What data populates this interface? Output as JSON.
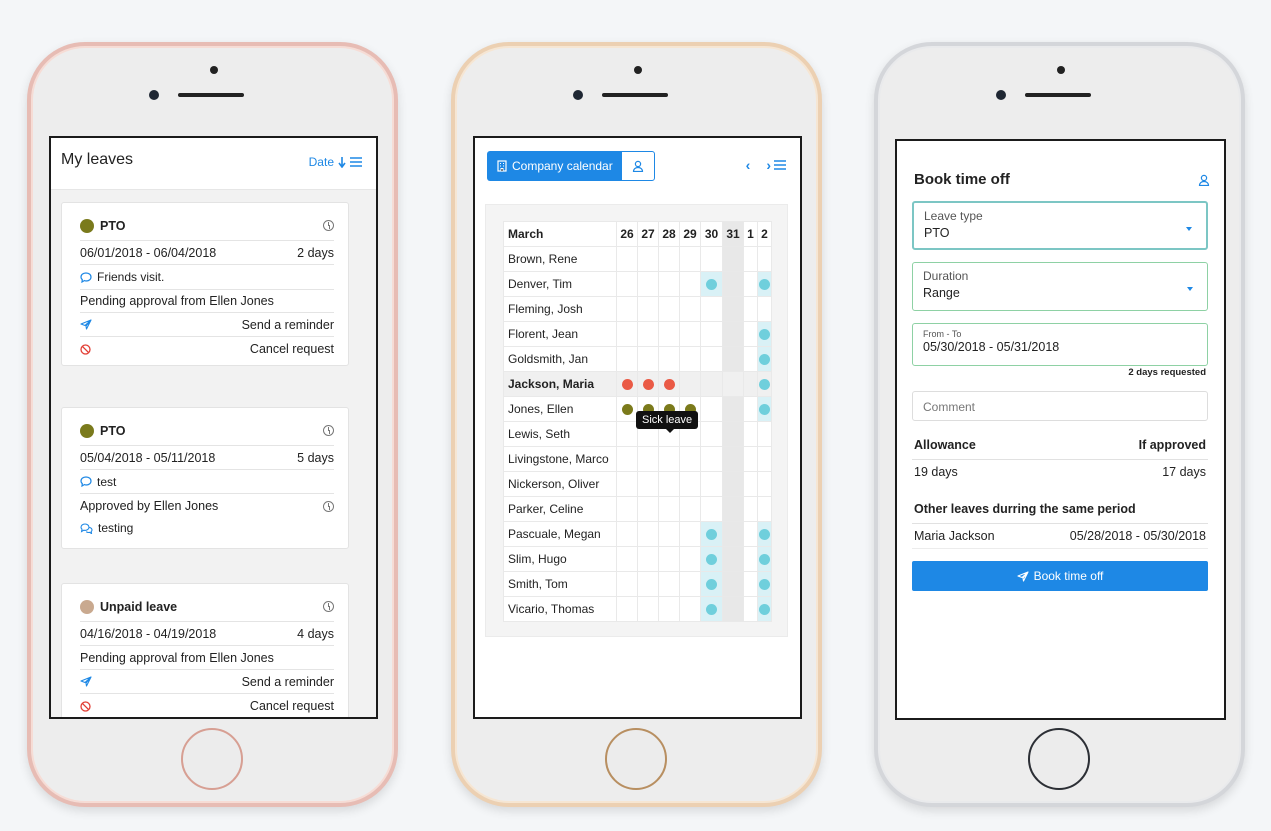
{
  "phone1": {
    "title": "My leaves",
    "sort_label": "Date",
    "cards": [
      {
        "type": "PTO",
        "color": "#7a7a1c",
        "dates": "06/01/2018 - 06/04/2018",
        "duration": "2 days",
        "note": "Friends visit.",
        "status": "Pending approval from Ellen Jones",
        "reminder": "Send a reminder",
        "cancel": "Cancel request"
      },
      {
        "type": "PTO",
        "color": "#7a7a1c",
        "dates": "05/04/2018 - 05/11/2018",
        "duration": "5 days",
        "note": "test",
        "status": "Approved by Ellen Jones",
        "reply": "testing"
      },
      {
        "type": "Unpaid leave",
        "color": "#c9a98f",
        "dates": "04/16/2018 - 04/19/2018",
        "duration": "4 days",
        "status": "Pending approval from Ellen Jones",
        "reminder": "Send a reminder",
        "cancel": "Cancel request"
      }
    ]
  },
  "phone2": {
    "calendar_label": "Company calendar",
    "month": "March",
    "days": [
      "26",
      "27",
      "28",
      "29",
      "30",
      "31",
      "1",
      "2"
    ],
    "tooltip": "Sick leave",
    "rows": [
      {
        "name": "Brown, Rene",
        "marks": [
          "",
          "",
          "",
          "",
          "",
          "",
          "",
          ""
        ]
      },
      {
        "name": "Denver, Tim",
        "marks": [
          "",
          "",
          "",
          "",
          "cy",
          "",
          "",
          "cy"
        ]
      },
      {
        "name": "Fleming, Josh",
        "marks": [
          "",
          "",
          "",
          "",
          "",
          "",
          "",
          ""
        ]
      },
      {
        "name": "Florent, Jean",
        "marks": [
          "",
          "",
          "",
          "",
          "",
          "",
          "",
          "cy"
        ]
      },
      {
        "name": "Goldsmith, Jan",
        "marks": [
          "",
          "",
          "",
          "",
          "",
          "",
          "",
          "cy"
        ]
      },
      {
        "name": "Jackson, Maria",
        "marks": [
          "rd",
          "rd",
          "rd",
          "",
          "",
          "",
          "",
          "cy"
        ],
        "highlight": true
      },
      {
        "name": "Jones, Ellen",
        "marks": [
          "ol",
          "ol",
          "ol",
          "ol",
          "",
          "",
          "",
          "cy"
        ]
      },
      {
        "name": "Lewis, Seth",
        "marks": [
          "",
          "",
          "",
          "",
          "",
          "",
          "",
          ""
        ]
      },
      {
        "name": "Livingstone, Marco",
        "marks": [
          "",
          "",
          "",
          "",
          "",
          "",
          "",
          ""
        ]
      },
      {
        "name": "Nickerson, Oliver",
        "marks": [
          "",
          "",
          "",
          "",
          "",
          "",
          "",
          ""
        ]
      },
      {
        "name": "Parker, Celine",
        "marks": [
          "",
          "",
          "",
          "",
          "",
          "",
          "",
          ""
        ]
      },
      {
        "name": "Pascuale, Megan",
        "marks": [
          "",
          "",
          "",
          "",
          "cy",
          "",
          "",
          "cy"
        ]
      },
      {
        "name": "Slim, Hugo",
        "marks": [
          "",
          "",
          "",
          "",
          "cy",
          "",
          "",
          "cy"
        ]
      },
      {
        "name": "Smith, Tom",
        "marks": [
          "",
          "",
          "",
          "",
          "cy",
          "",
          "",
          "cy"
        ]
      },
      {
        "name": "Vicario, Thomas",
        "marks": [
          "",
          "",
          "",
          "",
          "cy",
          "",
          "",
          "cy"
        ]
      }
    ]
  },
  "phone3": {
    "title": "Book time off",
    "leave_type_label": "Leave type",
    "leave_type_value": "PTO",
    "duration_label": "Duration",
    "duration_value": "Range",
    "from_to_label": "From - To",
    "from_to_value": "05/30/2018 - 05/31/2018",
    "days_requested": "2 days requested",
    "comment_placeholder": "Comment",
    "allowance_label": "Allowance",
    "if_approved_label": "If approved",
    "allowance_value": "19 days",
    "if_approved_value": "17 days",
    "other_leaves_label": "Other leaves durring the same period",
    "other_name": "Maria Jackson",
    "other_dates": "05/28/2018 - 05/30/2018",
    "button_label": "Book time off"
  },
  "colors": {
    "accent": "#1e88e5",
    "danger": "#e23d33",
    "pto": "#7a7a1c",
    "unpaid": "#c9a98f",
    "sick": "#ea5a45",
    "cyan_leave": "#6fcfdc"
  }
}
